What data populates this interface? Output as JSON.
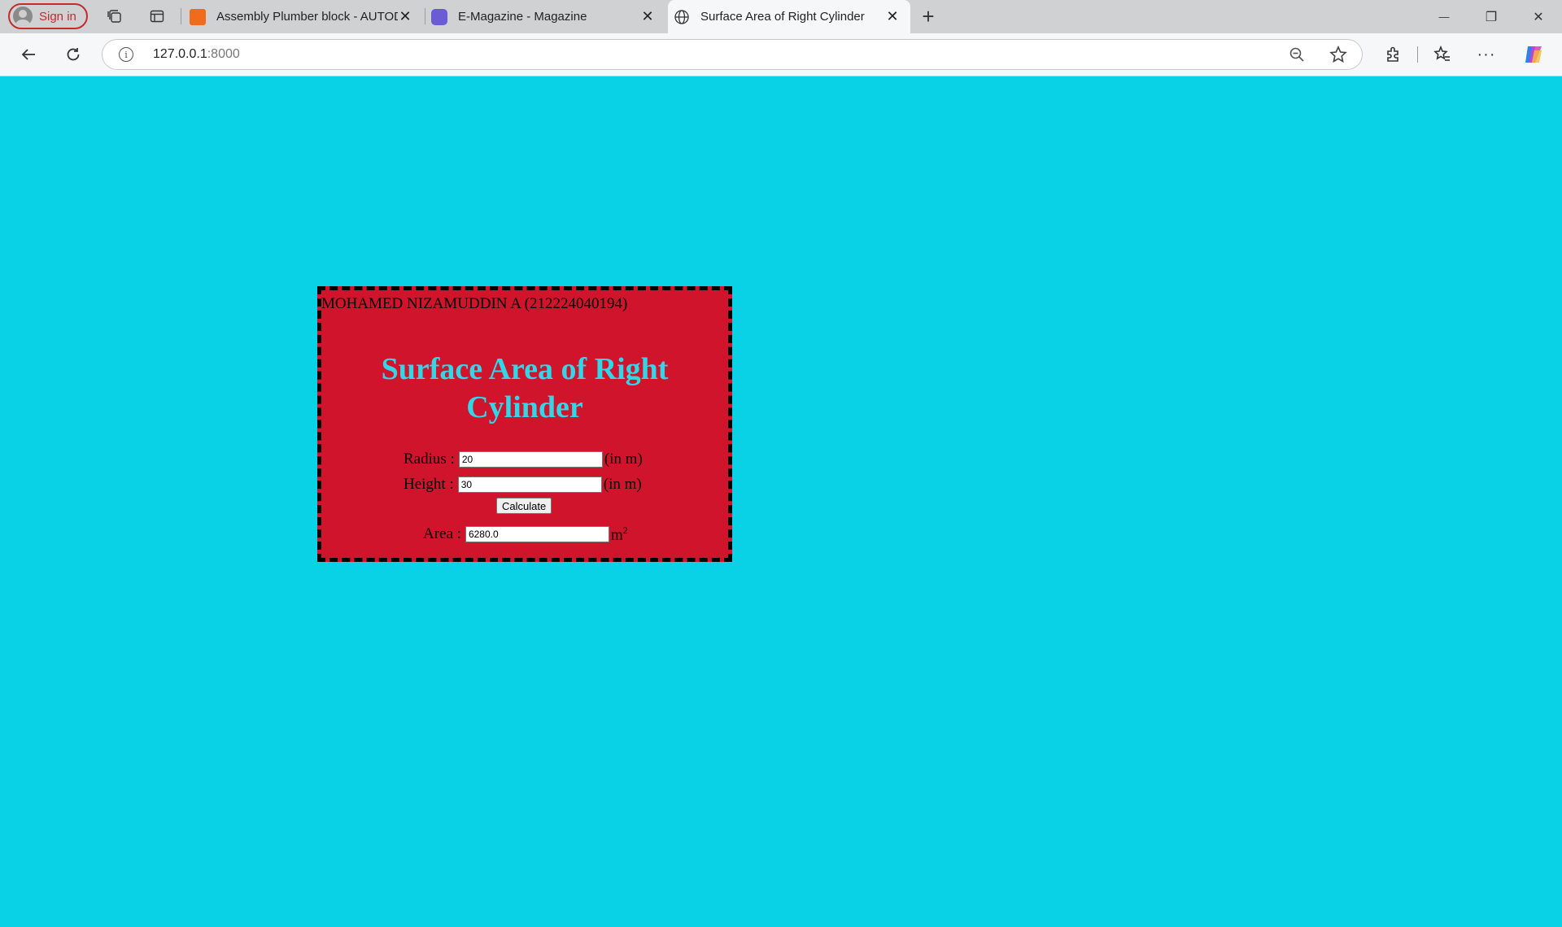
{
  "browser": {
    "signin_label": "Sign in",
    "tabs": [
      {
        "title": "Assembly Plumber block - AUTODESK",
        "close": "✕"
      },
      {
        "title": "E-Magazine - Magazine",
        "close": "✕"
      },
      {
        "title": "Surface Area of Right Cylinder",
        "close": "✕"
      }
    ],
    "new_tab": "+",
    "window": {
      "minimize": "—",
      "restore": "❐",
      "close": "✕"
    },
    "url_host": "127.0.0.1",
    "url_port": ":8000"
  },
  "page": {
    "student": "MOHAMED NIZAMUDDIN A (212224040194)",
    "heading": "Surface Area of Right Cylinder",
    "radius": {
      "label": "Radius :",
      "value": "20",
      "unit": "(in m)"
    },
    "height": {
      "label": "Height :",
      "value": "30",
      "unit": "(in m)"
    },
    "calculate_label": "Calculate",
    "area": {
      "label": "Area :",
      "value": "6280.0",
      "unit": "m",
      "unit_sup": "2"
    }
  },
  "colors": {
    "background": "#0ad2e6",
    "panel": "#d0142c",
    "heading": "#33d6e6"
  }
}
